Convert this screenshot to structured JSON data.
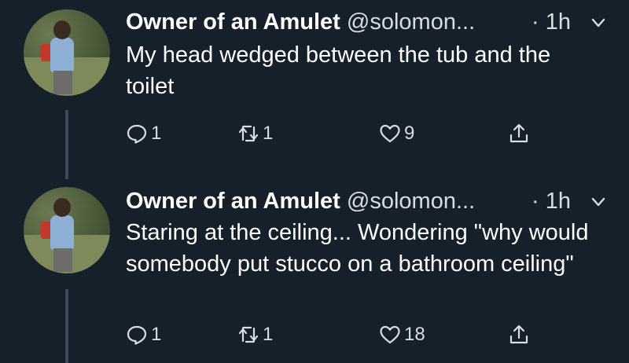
{
  "tweets": [
    {
      "name": "Owner of an Amulet",
      "handle": "@solomon...",
      "time": "· 1h",
      "text": "My head wedged between the tub and the toilet",
      "replies": "1",
      "retweets": "1",
      "likes": "9"
    },
    {
      "name": "Owner of an Amulet",
      "handle": "@solomon...",
      "time": "· 1h",
      "text": "Staring at the ceiling... Wondering \"why would somebody put stucco on a bathroom ceiling\"",
      "replies": "1",
      "retweets": "1",
      "likes": "18"
    }
  ],
  "colors": {
    "background": "#15202b",
    "text": "#ffffff",
    "secondary": "#d7dde3",
    "thread_line": "#3d4a57"
  },
  "icons": [
    "reply-icon",
    "retweet-icon",
    "like-icon",
    "share-icon",
    "chevron-down-icon"
  ]
}
